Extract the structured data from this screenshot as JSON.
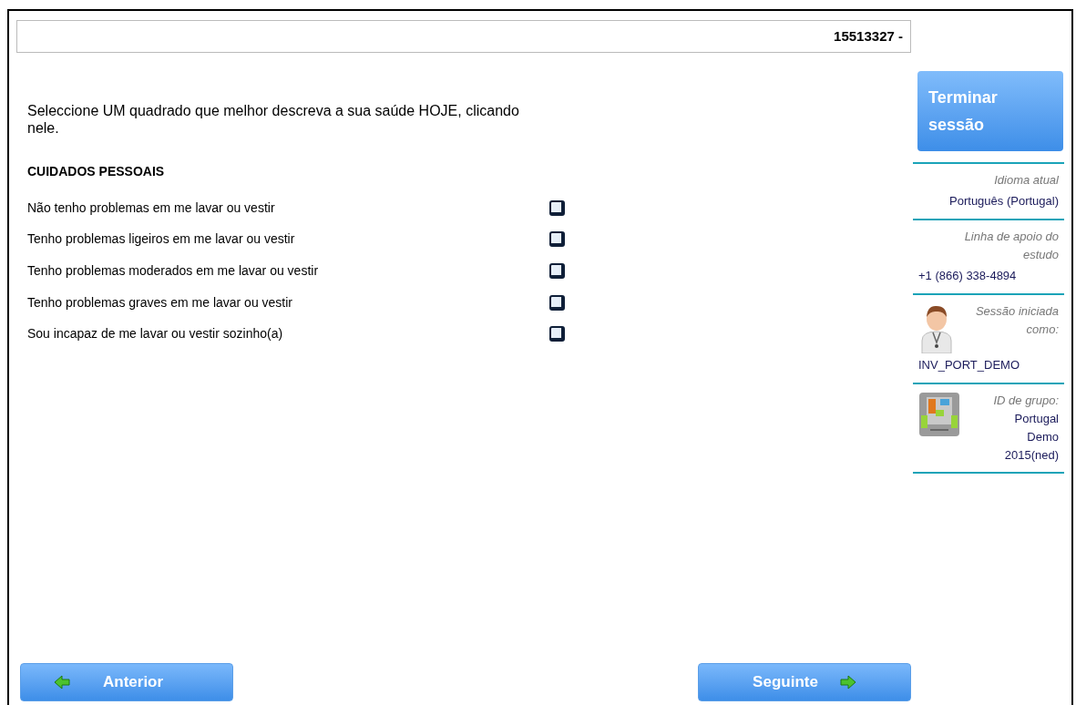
{
  "header": {
    "id_text": "15513327 -"
  },
  "instruction": "Seleccione UM quadrado que melhor descreva a sua saúde HOJE, clicando nele.",
  "section_title": "CUIDADOS PESSOAIS",
  "options": [
    {
      "label": "Não tenho problemas em me lavar ou vestir",
      "checked": false
    },
    {
      "label": "Tenho problemas ligeiros em me lavar ou vestir",
      "checked": false
    },
    {
      "label": "Tenho problemas moderados em me lavar ou vestir",
      "checked": false
    },
    {
      "label": "Tenho problemas graves em me lavar ou vestir",
      "checked": false
    },
    {
      "label": "Sou incapaz de me lavar ou vestir sozinho(a)",
      "checked": false
    }
  ],
  "end_session_button": "Terminar sessão",
  "sidebar": [
    {
      "kind": "language",
      "label": "Idioma atual",
      "value": "Português (Portugal)"
    },
    {
      "kind": "support",
      "label": "Linha de apoio do estudo",
      "value": "+1 (866) 338-4894"
    },
    {
      "kind": "user",
      "label": "Sessão iniciada como:",
      "value": "INV_PORT_DEMO"
    },
    {
      "kind": "group",
      "label": "ID de grupo:",
      "value": "Portugal Demo 2015(ned)"
    }
  ],
  "nav": {
    "previous": "Anterior",
    "next": "Seguinte"
  }
}
